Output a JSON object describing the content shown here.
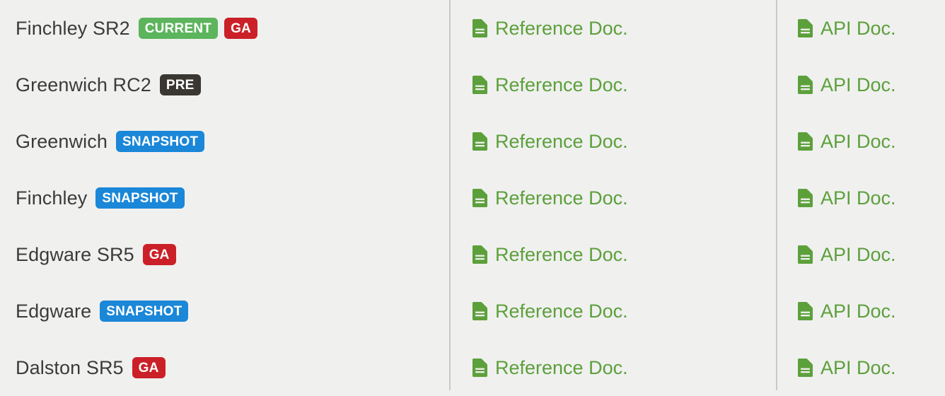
{
  "colors": {
    "background": "#f0f0ef",
    "divider": "#c9c9c9",
    "name_text": "#3b3b3b",
    "link_green": "#5ca03b",
    "badge_current": "#5cb45c",
    "badge_ga": "#cb2027",
    "badge_pre": "#3a3733",
    "badge_snapshot": "#1a87d8"
  },
  "columns": {
    "reference_doc_label": "Reference Doc.",
    "api_doc_label": "API Doc.",
    "doc_icon": "file-document-icon"
  },
  "rows": [
    {
      "name": "Finchley SR2",
      "badges": [
        {
          "label": "CURRENT",
          "kind": "current"
        },
        {
          "label": "GA",
          "kind": "ga"
        }
      ],
      "reference_doc": "Reference Doc.",
      "api_doc": "API Doc."
    },
    {
      "name": "Greenwich RC2",
      "badges": [
        {
          "label": "PRE",
          "kind": "pre"
        }
      ],
      "reference_doc": "Reference Doc.",
      "api_doc": "API Doc."
    },
    {
      "name": "Greenwich",
      "badges": [
        {
          "label": "SNAPSHOT",
          "kind": "snapshot"
        }
      ],
      "reference_doc": "Reference Doc.",
      "api_doc": "API Doc."
    },
    {
      "name": "Finchley",
      "badges": [
        {
          "label": "SNAPSHOT",
          "kind": "snapshot"
        }
      ],
      "reference_doc": "Reference Doc.",
      "api_doc": "API Doc."
    },
    {
      "name": "Edgware SR5",
      "badges": [
        {
          "label": "GA",
          "kind": "ga"
        }
      ],
      "reference_doc": "Reference Doc.",
      "api_doc": "API Doc."
    },
    {
      "name": "Edgware",
      "badges": [
        {
          "label": "SNAPSHOT",
          "kind": "snapshot"
        }
      ],
      "reference_doc": "Reference Doc.",
      "api_doc": "API Doc."
    },
    {
      "name": "Dalston SR5",
      "badges": [
        {
          "label": "GA",
          "kind": "ga"
        }
      ],
      "reference_doc": "Reference Doc.",
      "api_doc": "API Doc."
    }
  ]
}
